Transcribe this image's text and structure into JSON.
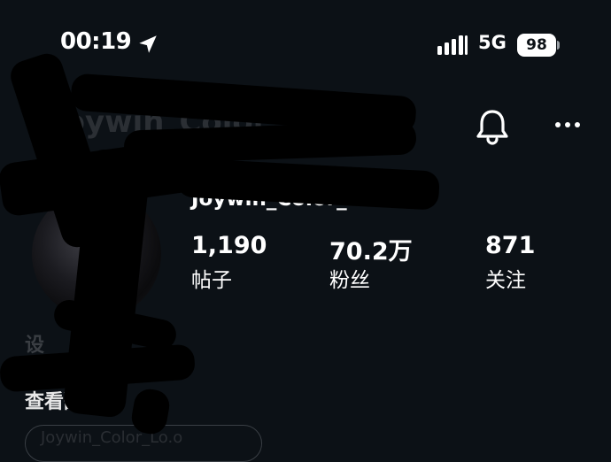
{
  "status_bar": {
    "time": "00:19",
    "network": "5G",
    "battery": "98"
  },
  "header": {
    "username": "Joywin_Color_Lo.o",
    "icons": [
      "bell-icon",
      "more-icon"
    ]
  },
  "profile": {
    "display_name": "Joywin_Color_Lo.o",
    "stats": [
      {
        "value": "1,190",
        "label": "帖子"
      },
      {
        "value": "70.2万",
        "label": "粉丝"
      },
      {
        "value": "871",
        "label": "关注"
      }
    ],
    "bio": "设",
    "translate_label": "查看翻译",
    "link_chip": "Joywin_Color_Lo.o"
  },
  "colors": {
    "background": "#0c1116",
    "text": "#ffffff"
  }
}
